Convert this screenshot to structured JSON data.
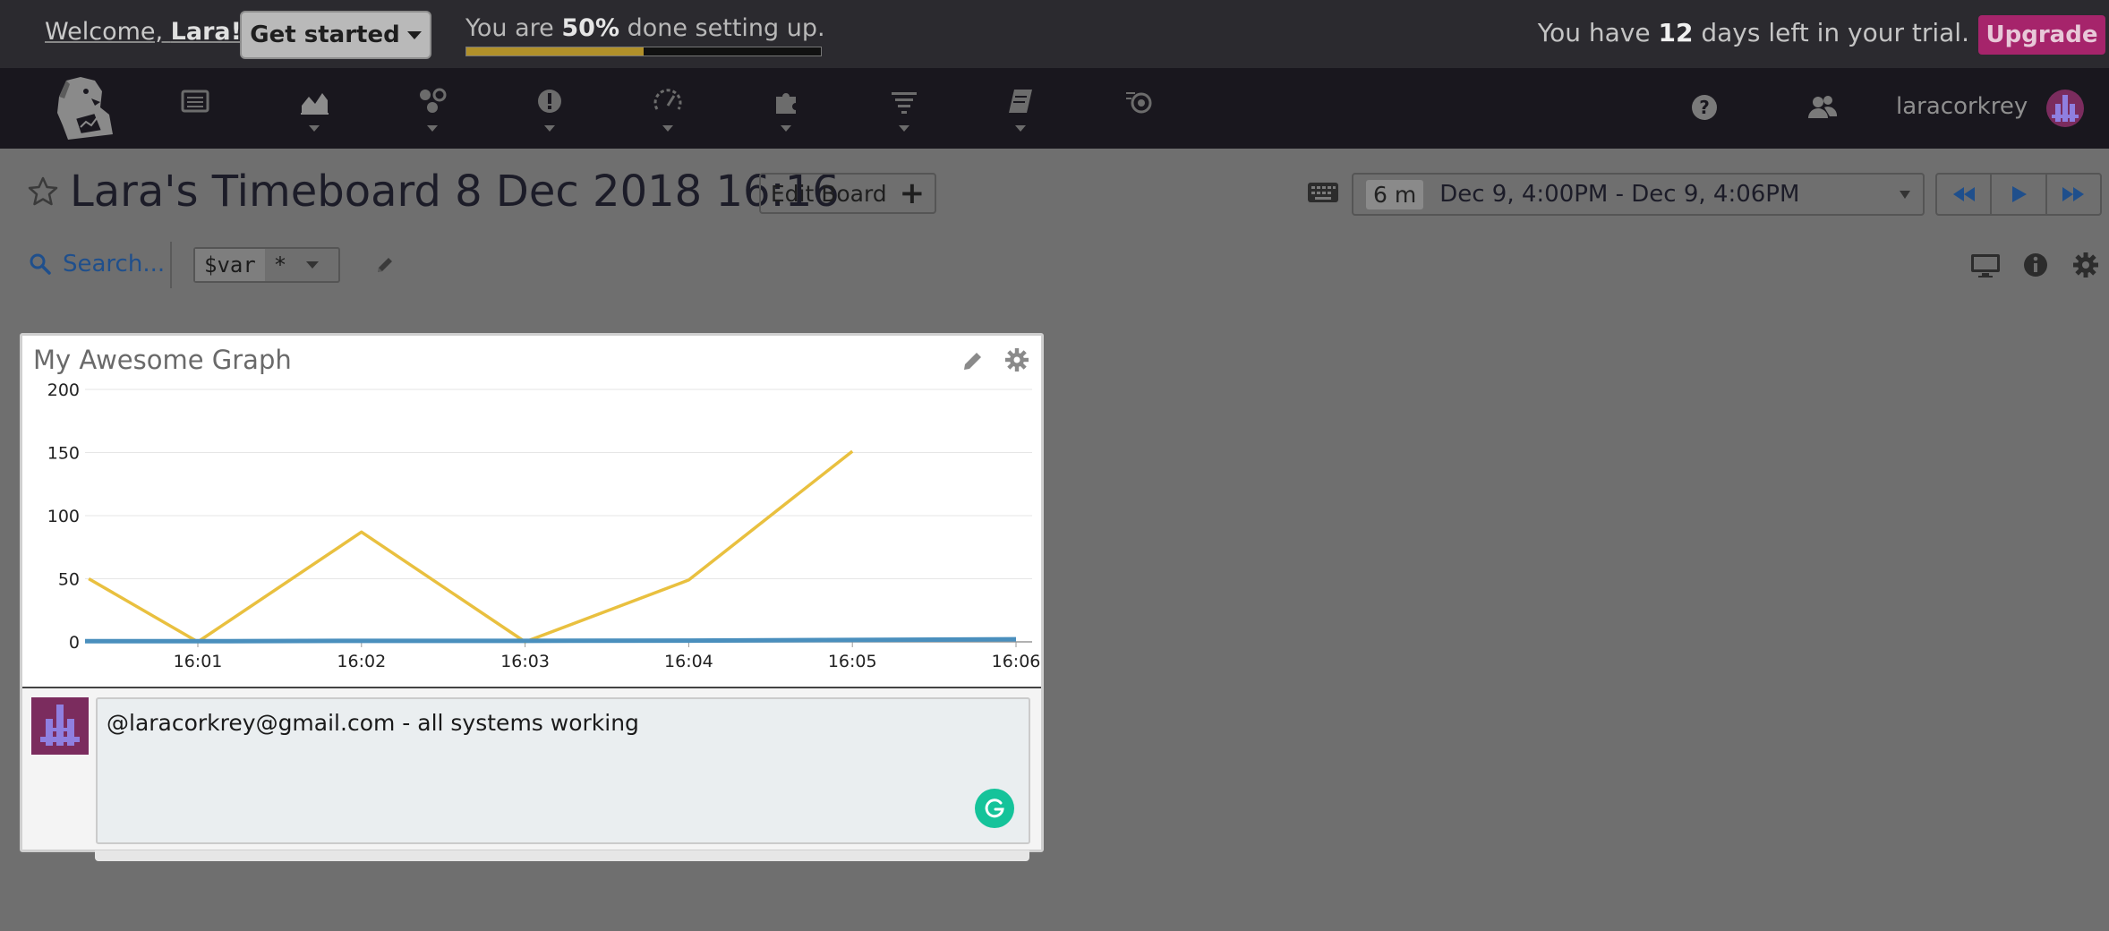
{
  "banner": {
    "welcome_prefix": "Welcome, ",
    "welcome_name": "Lara!",
    "get_started_label": "Get started",
    "setup_prefix": "You are ",
    "setup_percent": "50%",
    "setup_suffix": " done setting up.",
    "setup_progress_fraction": 0.5,
    "trial_prefix": "You have ",
    "trial_days": "12",
    "trial_suffix": " days left in your trial.",
    "upgrade_label": "Upgrade"
  },
  "nav": {
    "items": [
      "dashboards",
      "metrics",
      "integrations",
      "monitors",
      "apm",
      "infrastructure",
      "logs",
      "notebooks",
      "synthetics"
    ],
    "username": "laracorkrey"
  },
  "board": {
    "title": "Lara's Timeboard 8 Dec 2018 16:16",
    "edit_label": "Edit Board",
    "time_duration": "6 m",
    "time_range": "Dec 9, 4:00PM - Dec 9, 4:06PM"
  },
  "toolbar": {
    "search_label": "Search...",
    "var_name": "$var",
    "var_value": "*"
  },
  "widget": {
    "title": "My Awesome Graph",
    "comment": "@laracorkrey@gmail.com - all systems working"
  },
  "colors": {
    "series_primary": "#e9c03f",
    "series_secondary": "#4a8fbd",
    "upgrade": "#a6246b",
    "progress": "#b1902a"
  },
  "chart_data": {
    "type": "line",
    "x": [
      "16:00:20",
      "16:01",
      "16:02",
      "16:03",
      "16:04",
      "16:05",
      "16:06"
    ],
    "xticks": [
      "16:01",
      "16:02",
      "16:03",
      "16:04",
      "16:05",
      "16:06"
    ],
    "ylim": [
      0,
      200
    ],
    "yticks": [
      0,
      50,
      100,
      150,
      200
    ],
    "series": [
      {
        "values": [
          50,
          0,
          87,
          0,
          49,
          151,
          null
        ]
      },
      {
        "values": [
          0.5,
          0.5,
          0.8,
          0.8,
          1,
          1.5,
          2
        ]
      }
    ]
  }
}
